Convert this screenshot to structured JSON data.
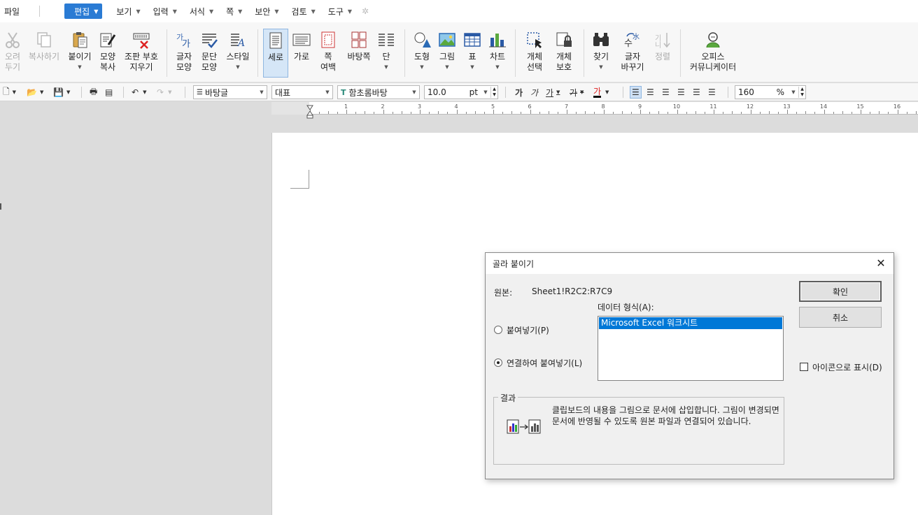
{
  "menubar": {
    "items": [
      {
        "label": "파일",
        "has_arrow": false
      },
      {
        "label": "편집",
        "has_arrow": true,
        "active": true
      },
      {
        "label": "보기",
        "has_arrow": true
      },
      {
        "label": "입력",
        "has_arrow": true
      },
      {
        "label": "서식",
        "has_arrow": true
      },
      {
        "label": "쪽",
        "has_arrow": true
      },
      {
        "label": "보안",
        "has_arrow": true
      },
      {
        "label": "검토",
        "has_arrow": true
      },
      {
        "label": "도구",
        "has_arrow": true
      }
    ]
  },
  "ribbon": {
    "cut": {
      "line1": "오려",
      "line2": "두기"
    },
    "copy": {
      "line1": "복사하기"
    },
    "paste": {
      "line1": "붙이기"
    },
    "format_copy": {
      "line1": "모양",
      "line2": "복사"
    },
    "erase": {
      "line1": "조판 부호",
      "line2": "지우기"
    },
    "char_shape": {
      "line1": "글자",
      "line2": "모양"
    },
    "para_shape": {
      "line1": "문단",
      "line2": "모양"
    },
    "style": {
      "line1": "스타일"
    },
    "vertical": {
      "line1": "세로"
    },
    "horizontal": {
      "line1": "가로"
    },
    "page_margin": {
      "line1": "쪽",
      "line2": "여백"
    },
    "background_page": {
      "line1": "바탕쪽"
    },
    "column": {
      "line1": "단"
    },
    "shape": {
      "line1": "도형"
    },
    "picture": {
      "line1": "그림"
    },
    "table": {
      "line1": "표"
    },
    "chart": {
      "line1": "차트"
    },
    "object_select": {
      "line1": "개체",
      "line2": "선택"
    },
    "object_protect": {
      "line1": "개체",
      "line2": "보호"
    },
    "find": {
      "line1": "찾기"
    },
    "replace": {
      "line1": "글자",
      "line2": "바꾸기"
    },
    "sort": {
      "line1": "정렬"
    },
    "office_communicator": {
      "line1": "오피스",
      "line2": "커뮤니케이터"
    }
  },
  "format_toolbar": {
    "style_value": "바탕글",
    "lang_value": "대표",
    "font_value": "함초롬바탕",
    "size_value": "10.0",
    "size_unit": "pt",
    "zoom_value": "160",
    "zoom_unit": "%"
  },
  "ruler": {
    "numbers": [
      "1",
      "2",
      "3",
      "4",
      "5",
      "6",
      "7",
      "8",
      "9",
      "10",
      "11",
      "12",
      "13",
      "14",
      "15",
      "16"
    ]
  },
  "dialog": {
    "title": "골라 붙이기",
    "source_label": "원본:",
    "source_value": "Sheet1!R2C2:R7C9",
    "data_format_label": "데이터 형식(A):",
    "list_items": [
      "Microsoft Excel 워크시트"
    ],
    "paste_option": "붙여넣기(P)",
    "paste_link_option": "연결하여 붙여넣기(L)",
    "ok_label": "확인",
    "cancel_label": "취소",
    "show_as_icon_label": "아이콘으로 표시(D)",
    "result_title": "결과",
    "result_text": "클립보드의 내용을 그림으로 문서에 삽입합니다. 그림이 변경되면 문서에 반영될 수 있도록 원본 파일과 연결되어 있습니다."
  }
}
